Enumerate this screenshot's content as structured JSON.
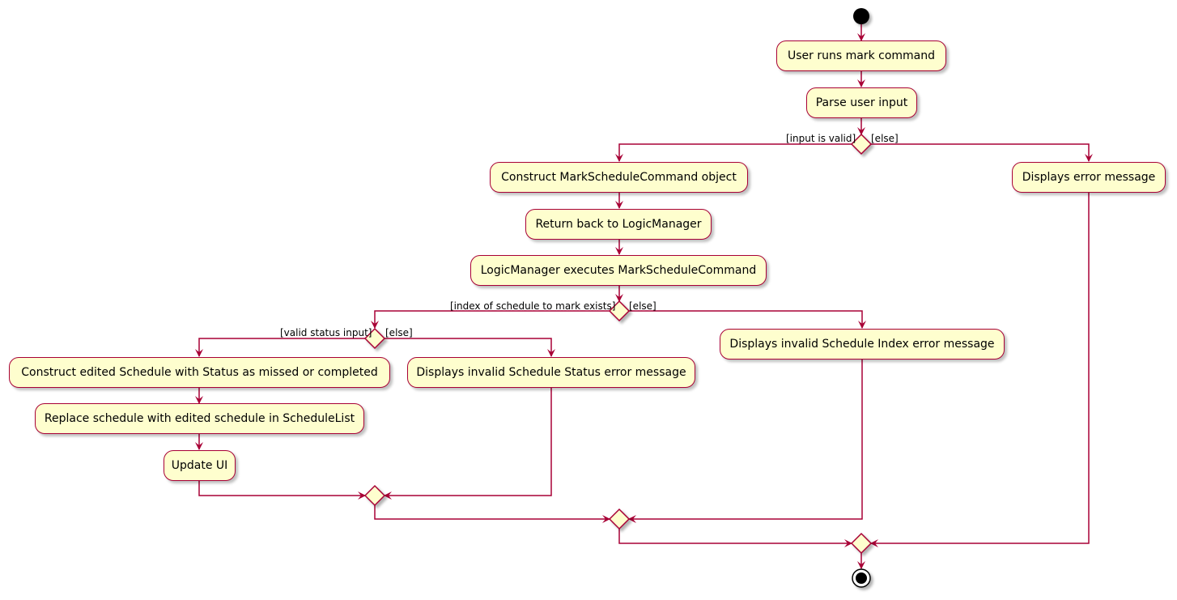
{
  "diagram": {
    "type": "activity",
    "colors": {
      "line": "#A80036",
      "fill": "#FEFECE",
      "node": "#000000"
    },
    "activities": {
      "user_runs": "User runs mark command",
      "parse": "Parse user input",
      "construct_cmd": "Construct MarkScheduleCommand object",
      "return_logic": "Return back to LogicManager",
      "execute": "LogicManager executes MarkScheduleCommand",
      "display_error": "Displays error message",
      "construct_edited": "Construct edited Schedule with Status as missed or completed",
      "replace": "Replace schedule with edited schedule in ScheduleList",
      "update_ui": "Update UI",
      "invalid_status": "Displays invalid Schedule Status error message",
      "invalid_index": "Displays invalid Schedule Index error message"
    },
    "guards": {
      "input_valid": "[input is valid]",
      "else1": "[else]",
      "index_exists": "[index of schedule to mark exists]",
      "else2": "[else]",
      "valid_status": "[valid status input]",
      "else3": "[else]"
    }
  }
}
